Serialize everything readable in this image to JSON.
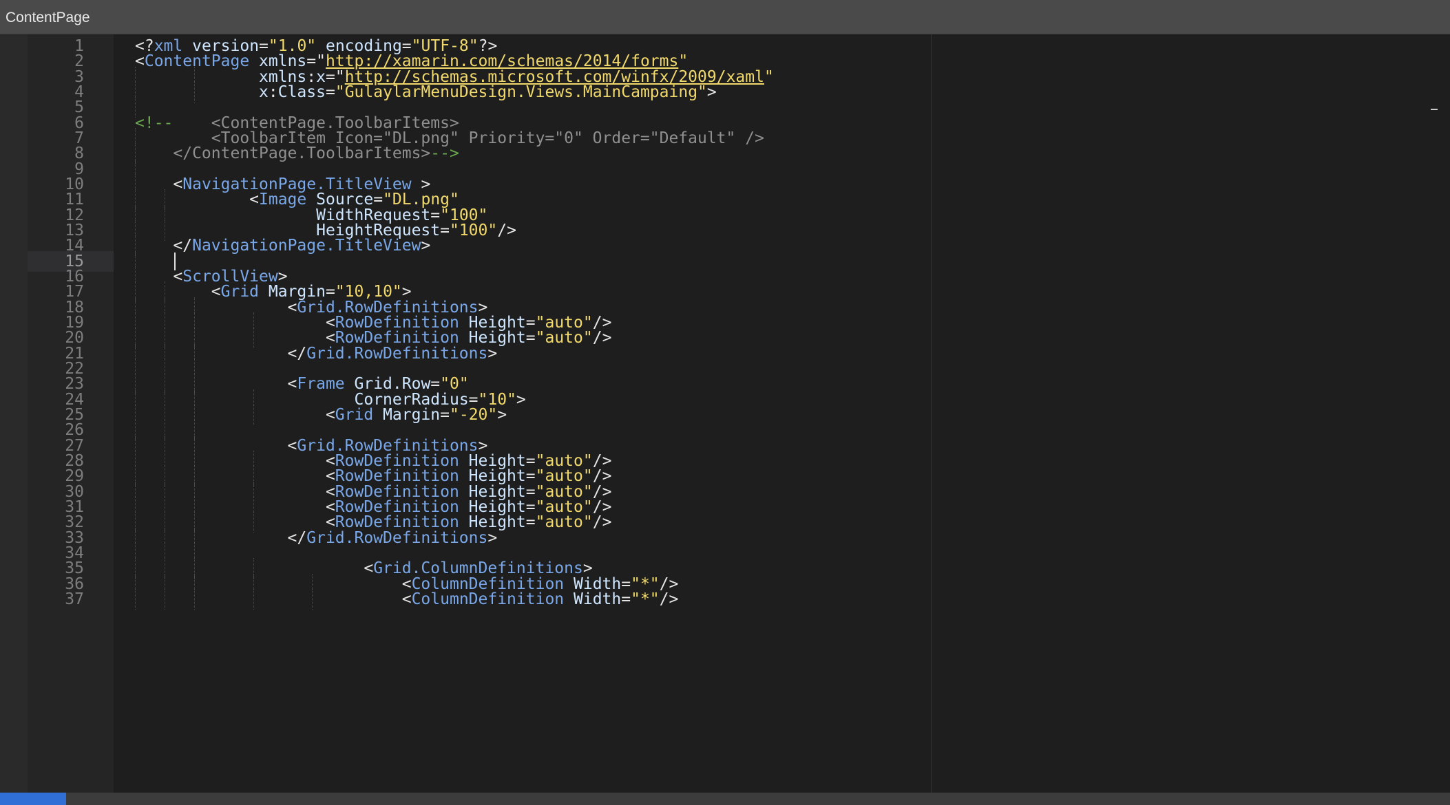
{
  "window": {
    "title": "ContentPage"
  },
  "editor": {
    "current_line": 15,
    "lines": [
      {
        "n": "1",
        "indent": 0,
        "tokens": [
          {
            "t": "punct",
            "v": "<?"
          },
          {
            "t": "tag",
            "v": "xml"
          },
          {
            "t": "punct",
            "v": " "
          },
          {
            "t": "attr",
            "v": "version"
          },
          {
            "t": "punct",
            "v": "="
          },
          {
            "t": "str",
            "v": "\"1.0\""
          },
          {
            "t": "punct",
            "v": " "
          },
          {
            "t": "attr",
            "v": "encoding"
          },
          {
            "t": "punct",
            "v": "="
          },
          {
            "t": "str",
            "v": "\"UTF-8\""
          },
          {
            "t": "punct",
            "v": "?>"
          }
        ]
      },
      {
        "n": "2",
        "indent": 0,
        "tokens": [
          {
            "t": "punct",
            "v": "<"
          },
          {
            "t": "tag",
            "v": "ContentPage"
          },
          {
            "t": "punct",
            "v": " "
          },
          {
            "t": "attr",
            "v": "xmlns"
          },
          {
            "t": "punct",
            "v": "=\""
          },
          {
            "t": "url",
            "v": "http://xamarin.com/schemas/2014/forms"
          },
          {
            "t": "str",
            "v": "\""
          }
        ]
      },
      {
        "n": "3",
        "indent": 0,
        "guides": [
          0,
          8
        ],
        "tokens": [
          {
            "t": "punct",
            "v": "             "
          },
          {
            "t": "attr",
            "v": "xmlns"
          },
          {
            "t": "punct",
            "v": ":"
          },
          {
            "t": "attr",
            "v": "x"
          },
          {
            "t": "punct",
            "v": "=\""
          },
          {
            "t": "url",
            "v": "http://schemas.microsoft.com/winfx/2009/xaml"
          },
          {
            "t": "str",
            "v": "\""
          }
        ]
      },
      {
        "n": "4",
        "indent": 0,
        "guides": [
          0,
          8
        ],
        "tokens": [
          {
            "t": "punct",
            "v": "             "
          },
          {
            "t": "attr",
            "v": "x"
          },
          {
            "t": "punct",
            "v": ":"
          },
          {
            "t": "attr",
            "v": "Class"
          },
          {
            "t": "punct",
            "v": "="
          },
          {
            "t": "str",
            "v": "\"GulaylarMenuDesign.Views.MainCampaing\""
          },
          {
            "t": "punct",
            "v": ">"
          }
        ]
      },
      {
        "n": "5",
        "indent": 0,
        "guides": [
          0
        ],
        "tokens": []
      },
      {
        "n": "6",
        "indent": 0,
        "tokens": [
          {
            "t": "comment-mark",
            "v": "<!--"
          },
          {
            "t": "comment",
            "v": "    <ContentPage.ToolbarItems>"
          }
        ]
      },
      {
        "n": "7",
        "indent": 0,
        "guides": [
          0
        ],
        "tokens": [
          {
            "t": "comment",
            "v": "        <ToolbarItem Icon=\"DL.png\" Priority=\"0\" Order=\"Default\" />"
          }
        ]
      },
      {
        "n": "8",
        "indent": 0,
        "guides": [
          0
        ],
        "tokens": [
          {
            "t": "comment",
            "v": "    </ContentPage.ToolbarItems>"
          },
          {
            "t": "comment-mark",
            "v": "-->"
          }
        ]
      },
      {
        "n": "9",
        "indent": 0,
        "guides": [
          0
        ],
        "tokens": []
      },
      {
        "n": "10",
        "indent": 0,
        "guides": [
          0
        ],
        "tokens": [
          {
            "t": "punct",
            "v": "    <"
          },
          {
            "t": "tag",
            "v": "NavigationPage.TitleView"
          },
          {
            "t": "punct",
            "v": " >"
          }
        ]
      },
      {
        "n": "11",
        "indent": 0,
        "guides": [
          0,
          4
        ],
        "tokens": [
          {
            "t": "punct",
            "v": "            <"
          },
          {
            "t": "tag",
            "v": "Image"
          },
          {
            "t": "punct",
            "v": " "
          },
          {
            "t": "attr",
            "v": "Source"
          },
          {
            "t": "punct",
            "v": "="
          },
          {
            "t": "str",
            "v": "\"DL.png\""
          }
        ]
      },
      {
        "n": "12",
        "indent": 0,
        "guides": [
          0,
          4
        ],
        "tokens": [
          {
            "t": "punct",
            "v": "                   "
          },
          {
            "t": "attr",
            "v": "WidthRequest"
          },
          {
            "t": "punct",
            "v": "="
          },
          {
            "t": "str",
            "v": "\"100\""
          }
        ]
      },
      {
        "n": "13",
        "indent": 0,
        "guides": [
          0,
          4
        ],
        "tokens": [
          {
            "t": "punct",
            "v": "                   "
          },
          {
            "t": "attr",
            "v": "HeightRequest"
          },
          {
            "t": "punct",
            "v": "="
          },
          {
            "t": "str",
            "v": "\"100\""
          },
          {
            "t": "punct",
            "v": "/>"
          }
        ]
      },
      {
        "n": "14",
        "indent": 0,
        "guides": [
          0
        ],
        "tokens": [
          {
            "t": "punct",
            "v": "    </"
          },
          {
            "t": "tag",
            "v": "NavigationPage.TitleView"
          },
          {
            "t": "punct",
            "v": ">"
          }
        ]
      },
      {
        "n": "15",
        "indent": 0,
        "guides": [
          0
        ],
        "tokens": []
      },
      {
        "n": "16",
        "indent": 0,
        "guides": [
          0
        ],
        "tokens": [
          {
            "t": "punct",
            "v": "    <"
          },
          {
            "t": "tag",
            "v": "ScrollView"
          },
          {
            "t": "punct",
            "v": ">"
          }
        ]
      },
      {
        "n": "17",
        "indent": 0,
        "guides": [
          0,
          4
        ],
        "tokens": [
          {
            "t": "punct",
            "v": "        <"
          },
          {
            "t": "tag",
            "v": "Grid"
          },
          {
            "t": "punct",
            "v": " "
          },
          {
            "t": "attr",
            "v": "Margin"
          },
          {
            "t": "punct",
            "v": "="
          },
          {
            "t": "str",
            "v": "\"10,10\""
          },
          {
            "t": "punct",
            "v": ">"
          }
        ]
      },
      {
        "n": "18",
        "indent": 0,
        "guides": [
          0,
          4,
          8
        ],
        "tokens": [
          {
            "t": "punct",
            "v": "                <"
          },
          {
            "t": "tag",
            "v": "Grid.RowDefinitions"
          },
          {
            "t": "punct",
            "v": ">"
          }
        ]
      },
      {
        "n": "19",
        "indent": 0,
        "guides": [
          0,
          4,
          8,
          16
        ],
        "tokens": [
          {
            "t": "punct",
            "v": "                    <"
          },
          {
            "t": "tag",
            "v": "RowDefinition"
          },
          {
            "t": "punct",
            "v": " "
          },
          {
            "t": "attr",
            "v": "Height"
          },
          {
            "t": "punct",
            "v": "="
          },
          {
            "t": "str",
            "v": "\"auto\""
          },
          {
            "t": "punct",
            "v": "/>"
          }
        ]
      },
      {
        "n": "20",
        "indent": 0,
        "guides": [
          0,
          4,
          8,
          16
        ],
        "tokens": [
          {
            "t": "punct",
            "v": "                    <"
          },
          {
            "t": "tag",
            "v": "RowDefinition"
          },
          {
            "t": "punct",
            "v": " "
          },
          {
            "t": "attr",
            "v": "Height"
          },
          {
            "t": "punct",
            "v": "="
          },
          {
            "t": "str",
            "v": "\"auto\""
          },
          {
            "t": "punct",
            "v": "/>"
          }
        ]
      },
      {
        "n": "21",
        "indent": 0,
        "guides": [
          0,
          4,
          8
        ],
        "tokens": [
          {
            "t": "punct",
            "v": "                </"
          },
          {
            "t": "tag",
            "v": "Grid.RowDefinitions"
          },
          {
            "t": "punct",
            "v": ">"
          }
        ]
      },
      {
        "n": "22",
        "indent": 0,
        "guides": [
          0,
          4,
          8
        ],
        "tokens": []
      },
      {
        "n": "23",
        "indent": 0,
        "guides": [
          0,
          4,
          8
        ],
        "tokens": [
          {
            "t": "punct",
            "v": "                <"
          },
          {
            "t": "tag",
            "v": "Frame"
          },
          {
            "t": "punct",
            "v": " "
          },
          {
            "t": "attr",
            "v": "Grid.Row"
          },
          {
            "t": "punct",
            "v": "="
          },
          {
            "t": "str",
            "v": "\"0\""
          }
        ]
      },
      {
        "n": "24",
        "indent": 0,
        "guides": [
          0,
          4,
          8,
          16
        ],
        "tokens": [
          {
            "t": "punct",
            "v": "                       "
          },
          {
            "t": "attr",
            "v": "CornerRadius"
          },
          {
            "t": "punct",
            "v": "="
          },
          {
            "t": "str",
            "v": "\"10\""
          },
          {
            "t": "punct",
            "v": ">"
          }
        ]
      },
      {
        "n": "25",
        "indent": 0,
        "guides": [
          0,
          4,
          8,
          16
        ],
        "tokens": [
          {
            "t": "punct",
            "v": "                    <"
          },
          {
            "t": "tag",
            "v": "Grid"
          },
          {
            "t": "punct",
            "v": " "
          },
          {
            "t": "attr",
            "v": "Margin"
          },
          {
            "t": "punct",
            "v": "="
          },
          {
            "t": "str",
            "v": "\"-20\""
          },
          {
            "t": "punct",
            "v": ">"
          }
        ]
      },
      {
        "n": "26",
        "indent": 0,
        "guides": [
          0,
          4,
          8
        ],
        "tokens": []
      },
      {
        "n": "27",
        "indent": 0,
        "guides": [
          0,
          4,
          8
        ],
        "tokens": [
          {
            "t": "punct",
            "v": "                <"
          },
          {
            "t": "tag",
            "v": "Grid.RowDefinitions"
          },
          {
            "t": "punct",
            "v": ">"
          }
        ]
      },
      {
        "n": "28",
        "indent": 0,
        "guides": [
          0,
          4,
          8,
          16
        ],
        "tokens": [
          {
            "t": "punct",
            "v": "                    <"
          },
          {
            "t": "tag",
            "v": "RowDefinition"
          },
          {
            "t": "punct",
            "v": " "
          },
          {
            "t": "attr",
            "v": "Height"
          },
          {
            "t": "punct",
            "v": "="
          },
          {
            "t": "str",
            "v": "\"auto\""
          },
          {
            "t": "punct",
            "v": "/>"
          }
        ]
      },
      {
        "n": "29",
        "indent": 0,
        "guides": [
          0,
          4,
          8,
          16
        ],
        "tokens": [
          {
            "t": "punct",
            "v": "                    <"
          },
          {
            "t": "tag",
            "v": "RowDefinition"
          },
          {
            "t": "punct",
            "v": " "
          },
          {
            "t": "attr",
            "v": "Height"
          },
          {
            "t": "punct",
            "v": "="
          },
          {
            "t": "str",
            "v": "\"auto\""
          },
          {
            "t": "punct",
            "v": "/>"
          }
        ]
      },
      {
        "n": "30",
        "indent": 0,
        "guides": [
          0,
          4,
          8,
          16
        ],
        "tokens": [
          {
            "t": "punct",
            "v": "                    <"
          },
          {
            "t": "tag",
            "v": "RowDefinition"
          },
          {
            "t": "punct",
            "v": " "
          },
          {
            "t": "attr",
            "v": "Height"
          },
          {
            "t": "punct",
            "v": "="
          },
          {
            "t": "str",
            "v": "\"auto\""
          },
          {
            "t": "punct",
            "v": "/>"
          }
        ]
      },
      {
        "n": "31",
        "indent": 0,
        "guides": [
          0,
          4,
          8,
          16
        ],
        "tokens": [
          {
            "t": "punct",
            "v": "                    <"
          },
          {
            "t": "tag",
            "v": "RowDefinition"
          },
          {
            "t": "punct",
            "v": " "
          },
          {
            "t": "attr",
            "v": "Height"
          },
          {
            "t": "punct",
            "v": "="
          },
          {
            "t": "str",
            "v": "\"auto\""
          },
          {
            "t": "punct",
            "v": "/>"
          }
        ]
      },
      {
        "n": "32",
        "indent": 0,
        "guides": [
          0,
          4,
          8,
          16
        ],
        "tokens": [
          {
            "t": "punct",
            "v": "                    <"
          },
          {
            "t": "tag",
            "v": "RowDefinition"
          },
          {
            "t": "punct",
            "v": " "
          },
          {
            "t": "attr",
            "v": "Height"
          },
          {
            "t": "punct",
            "v": "="
          },
          {
            "t": "str",
            "v": "\"auto\""
          },
          {
            "t": "punct",
            "v": "/>"
          }
        ]
      },
      {
        "n": "33",
        "indent": 0,
        "guides": [
          0,
          4,
          8
        ],
        "tokens": [
          {
            "t": "punct",
            "v": "                </"
          },
          {
            "t": "tag",
            "v": "Grid.RowDefinitions"
          },
          {
            "t": "punct",
            "v": ">"
          }
        ]
      },
      {
        "n": "34",
        "indent": 0,
        "guides": [
          0,
          4,
          8
        ],
        "tokens": []
      },
      {
        "n": "35",
        "indent": 0,
        "guides": [
          0,
          4,
          8,
          16
        ],
        "tokens": [
          {
            "t": "punct",
            "v": "                        <"
          },
          {
            "t": "tag",
            "v": "Grid.ColumnDefinitions"
          },
          {
            "t": "punct",
            "v": ">"
          }
        ]
      },
      {
        "n": "36",
        "indent": 0,
        "guides": [
          0,
          4,
          8,
          16,
          24
        ],
        "tokens": [
          {
            "t": "punct",
            "v": "                            <"
          },
          {
            "t": "tag",
            "v": "ColumnDefinition"
          },
          {
            "t": "punct",
            "v": " "
          },
          {
            "t": "attr",
            "v": "Width"
          },
          {
            "t": "punct",
            "v": "="
          },
          {
            "t": "str",
            "v": "\"*\""
          },
          {
            "t": "punct",
            "v": "/>"
          }
        ]
      },
      {
        "n": "37",
        "indent": 0,
        "guides": [
          0,
          4,
          8,
          16,
          24
        ],
        "tokens": [
          {
            "t": "punct",
            "v": "                            <"
          },
          {
            "t": "tag",
            "v": "ColumnDefinition"
          },
          {
            "t": "punct",
            "v": " "
          },
          {
            "t": "attr",
            "v": "Width"
          },
          {
            "t": "punct",
            "v": "="
          },
          {
            "t": "str",
            "v": "\"*\""
          },
          {
            "t": "punct",
            "v": "/>"
          }
        ]
      }
    ]
  },
  "statusbar": {
    "tabs": []
  },
  "colors": {
    "tag": "#79a7e8",
    "attr": "#cfe6ff",
    "string": "#f1d96b",
    "comment": "#8f8f8f",
    "comment_mark": "#6aa84f",
    "active_tab": "#2f6fd6"
  }
}
